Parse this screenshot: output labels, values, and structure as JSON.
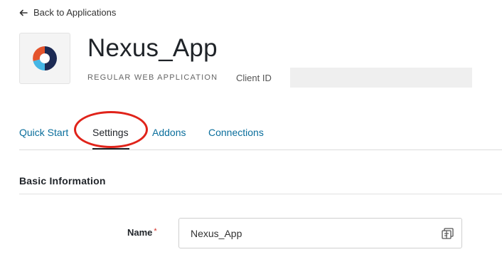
{
  "back_link": {
    "label": "Back to Applications"
  },
  "app": {
    "name": "Nexus_App",
    "type": "REGULAR WEB APPLICATION",
    "client_id_label": "Client ID",
    "client_id_value": ""
  },
  "tabs": [
    {
      "label": "Quick Start",
      "active": false
    },
    {
      "label": "Settings",
      "active": true
    },
    {
      "label": "Addons",
      "active": false
    },
    {
      "label": "Connections",
      "active": false
    }
  ],
  "section": {
    "title": "Basic Information"
  },
  "fields": {
    "name": {
      "label": "Name",
      "required_mark": "*",
      "value": "Nexus_App"
    }
  },
  "colors": {
    "link": "#0a6e9c",
    "annotation": "#e0231a",
    "required": "#d4312a",
    "logo_orange": "#e4542d",
    "logo_blue": "#45b6e5",
    "logo_navy": "#1c2a54"
  },
  "icons": {
    "back": "arrow-left-icon",
    "logo": "app-logo-icon",
    "field": "id-card-icon"
  }
}
